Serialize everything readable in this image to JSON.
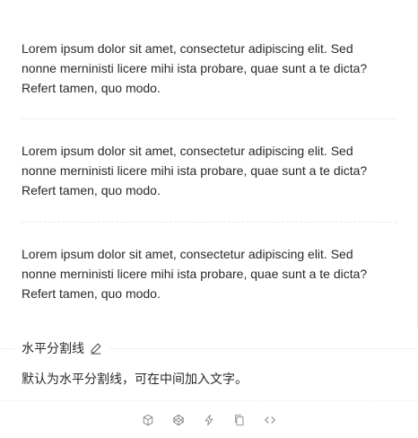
{
  "preview": {
    "paragraphs": [
      {
        "line1": "Lorem ipsum dolor sit amet, consectetur adipiscing elit. Sed",
        "line2": "nonne merninisti licere mihi ista probare, quae sunt a te dicta?",
        "line3": "Refert tamen, quo modo."
      },
      {
        "line1": "Lorem ipsum dolor sit amet, consectetur adipiscing elit. Sed",
        "line2": "nonne merninisti licere mihi ista probare, quae sunt a te dicta?",
        "line3": "Refert tamen, quo modo."
      },
      {
        "line1": "Lorem ipsum dolor sit amet, consectetur adipiscing elit. Sed",
        "line2": "nonne merninisti licere mihi ista probare, quae sunt a te dicta?",
        "line3": "Refert tamen, quo modo."
      }
    ],
    "divider_styles": [
      "solid",
      "dashed"
    ]
  },
  "meta": {
    "title": "水平分割线",
    "title_icon": "edit-icon",
    "description": "默认为水平分割线，可在中间加入文字。"
  },
  "actions": [
    {
      "name": "codesandbox-icon"
    },
    {
      "name": "codepen-icon"
    },
    {
      "name": "stackblitz-icon"
    },
    {
      "name": "copy-icon"
    },
    {
      "name": "expand-code-icon"
    }
  ],
  "colors": {
    "text": "#262626",
    "divider": "#f0f0f0",
    "icon": "#8c8c8c"
  }
}
